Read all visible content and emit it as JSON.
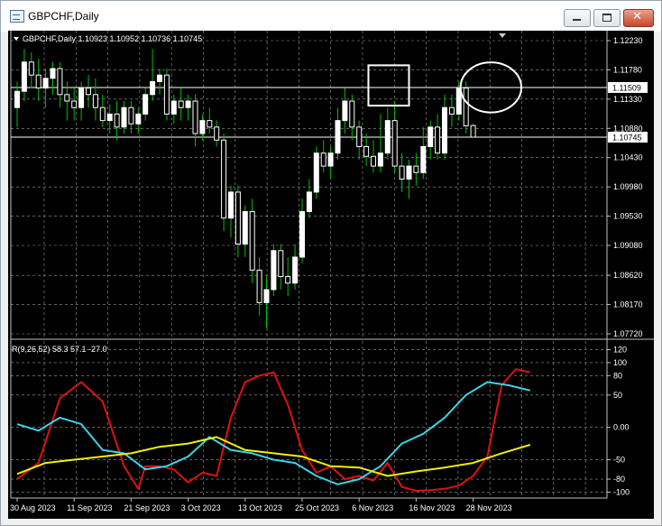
{
  "window": {
    "title": "GBPCHF,Daily"
  },
  "main_panel": {
    "header": "GBPCHF,Daily  1.10923 1.10952 1.10736 1.10745",
    "menu_arrow_icon": "triangle-down-icon"
  },
  "indicator_panel": {
    "header": "R(9,26,52) 58.3 57.1 -27.0"
  },
  "colors": {
    "background": "#000000",
    "grid": "#9a9a9a",
    "text": "#ffffff",
    "bull_candle": "#ffffff",
    "bear_candle": "#ffffff",
    "wick": "#00c000",
    "price_line": "#ffffff",
    "series_red": "#e01010",
    "series_cyan": "#3cd4e8",
    "series_yellow": "#f0f000",
    "annotation": "#ffffff",
    "price_label_bg": "#ffffff",
    "price_label_text": "#000000"
  },
  "chart_data": [
    {
      "type": "candlestick",
      "title": "GBPCHF,Daily",
      "ohlc_header": [
        "1.10923",
        "1.10952",
        "1.10736",
        "1.10745"
      ],
      "ylim": [
        1.0772,
        1.1223
      ],
      "yticks": [
        "1.12230",
        "1.11780",
        "1.11330",
        "1.10880",
        "1.10430",
        "1.09980",
        "1.09530",
        "1.09080",
        "1.08620",
        "1.08170",
        "1.07720"
      ],
      "x_labels": [
        "30 Aug 2023",
        "11 Sep 2023",
        "21 Sep 2023",
        "3 Oct 2023",
        "13 Oct 2023",
        "25 Oct 2023",
        "6 Nov 2023",
        "16 Nov 2023",
        "28 Nov 2023"
      ],
      "x_label_index": [
        0,
        8,
        16,
        24,
        32,
        40,
        48,
        56,
        64
      ],
      "price_lines": [
        {
          "value": 1.11509,
          "label": "1.11509"
        },
        {
          "value": 1.10745,
          "label": "1.10745"
        }
      ],
      "annotations": [
        {
          "shape": "rectangle",
          "from_index": 49.3,
          "to_index": 55.0,
          "y_top": 1.1185,
          "y_bottom": 1.1123
        },
        {
          "shape": "circle",
          "center_index": 66.5,
          "center_y": 1.1151,
          "radius_index": 3.0
        }
      ],
      "candles": [
        [
          1.112,
          1.116,
          1.109,
          1.1145
        ],
        [
          1.1145,
          1.121,
          1.113,
          1.119
        ],
        [
          1.119,
          1.1205,
          1.115,
          1.117
        ],
        [
          1.117,
          1.1195,
          1.113,
          1.115
        ],
        [
          1.115,
          1.118,
          1.112,
          1.1165
        ],
        [
          1.1165,
          1.119,
          1.114,
          1.118
        ],
        [
          1.118,
          1.119,
          1.112,
          1.114
        ],
        [
          1.114,
          1.116,
          1.11,
          1.113
        ],
        [
          1.113,
          1.115,
          1.11,
          1.112
        ],
        [
          1.112,
          1.116,
          1.11,
          1.115
        ],
        [
          1.115,
          1.117,
          1.112,
          1.114
        ],
        [
          1.114,
          1.1165,
          1.11,
          1.112
        ],
        [
          1.112,
          1.114,
          1.109,
          1.11
        ],
        [
          1.11,
          1.1125,
          1.108,
          1.111
        ],
        [
          1.111,
          1.113,
          1.107,
          1.109
        ],
        [
          1.109,
          1.113,
          1.108,
          1.112
        ],
        [
          1.112,
          1.113,
          1.108,
          1.1095
        ],
        [
          1.1095,
          1.112,
          1.108,
          1.111
        ],
        [
          1.111,
          1.115,
          1.11,
          1.114
        ],
        [
          1.114,
          1.121,
          1.113,
          1.116
        ],
        [
          1.116,
          1.118,
          1.114,
          1.117
        ],
        [
          1.117,
          1.118,
          1.11,
          1.111
        ],
        [
          1.111,
          1.114,
          1.1095,
          1.113
        ],
        [
          1.113,
          1.115,
          1.11,
          1.112
        ],
        [
          1.112,
          1.114,
          1.11,
          1.113
        ],
        [
          1.113,
          1.114,
          1.106,
          1.108
        ],
        [
          1.108,
          1.111,
          1.107,
          1.11
        ],
        [
          1.11,
          1.112,
          1.108,
          1.109
        ],
        [
          1.109,
          1.11,
          1.106,
          1.107
        ],
        [
          1.107,
          1.108,
          1.093,
          1.095
        ],
        [
          1.095,
          1.1,
          1.092,
          1.099
        ],
        [
          1.099,
          1.1,
          1.089,
          1.091
        ],
        [
          1.091,
          1.097,
          1.089,
          1.096
        ],
        [
          1.096,
          1.098,
          1.085,
          1.087
        ],
        [
          1.087,
          1.089,
          1.08,
          1.082
        ],
        [
          1.082,
          1.086,
          1.078,
          1.084
        ],
        [
          1.084,
          1.091,
          1.083,
          1.09
        ],
        [
          1.09,
          1.091,
          1.084,
          1.086
        ],
        [
          1.086,
          1.089,
          1.083,
          1.085
        ],
        [
          1.085,
          1.091,
          1.084,
          1.089
        ],
        [
          1.089,
          1.098,
          1.088,
          1.096
        ],
        [
          1.096,
          1.101,
          1.095,
          1.099
        ],
        [
          1.099,
          1.106,
          1.098,
          1.105
        ],
        [
          1.105,
          1.107,
          1.102,
          1.103
        ],
        [
          1.103,
          1.106,
          1.101,
          1.105
        ],
        [
          1.105,
          1.112,
          1.104,
          1.11
        ],
        [
          1.11,
          1.115,
          1.108,
          1.113
        ],
        [
          1.113,
          1.114,
          1.107,
          1.109
        ],
        [
          1.109,
          1.11,
          1.104,
          1.106
        ],
        [
          1.106,
          1.108,
          1.103,
          1.1045
        ],
        [
          1.1045,
          1.107,
          1.102,
          1.103
        ],
        [
          1.103,
          1.111,
          1.102,
          1.105
        ],
        [
          1.105,
          1.112,
          1.104,
          1.11
        ],
        [
          1.11,
          1.113,
          1.102,
          1.103
        ],
        [
          1.103,
          1.105,
          1.099,
          1.101
        ],
        [
          1.101,
          1.104,
          1.098,
          1.103
        ],
        [
          1.103,
          1.105,
          1.1,
          1.102
        ],
        [
          1.102,
          1.109,
          1.101,
          1.106
        ],
        [
          1.106,
          1.11,
          1.104,
          1.109
        ],
        [
          1.109,
          1.111,
          1.104,
          1.105
        ],
        [
          1.105,
          1.114,
          1.104,
          1.112
        ],
        [
          1.112,
          1.114,
          1.109,
          1.111
        ],
        [
          1.111,
          1.116,
          1.11,
          1.115
        ],
        [
          1.115,
          1.116,
          1.108,
          1.1092
        ],
        [
          1.10923,
          1.10952,
          1.10736,
          1.10745
        ]
      ]
    },
    {
      "type": "line",
      "title": "R(9,26,52)",
      "values_header": [
        "58.3",
        "57.1",
        "-27.0"
      ],
      "ylim": [
        -105,
        125
      ],
      "yticks": [
        "120",
        "100",
        "80",
        "50",
        "0.00",
        "-50",
        "-80",
        "-100"
      ],
      "ytick_values": [
        120,
        100,
        80,
        50,
        0,
        -50,
        -80,
        -100
      ],
      "series": [
        {
          "color": "series_red",
          "x": [
            0,
            3,
            6,
            9,
            12,
            15,
            17,
            18,
            20,
            22,
            24,
            26,
            28,
            30,
            32,
            34,
            36,
            38,
            40,
            42,
            44,
            46,
            48,
            50,
            52,
            54,
            56,
            58,
            60,
            62,
            64,
            66,
            68,
            70,
            72
          ],
          "values": [
            -80,
            -55,
            45,
            70,
            40,
            -60,
            -95,
            -60,
            -60,
            -65,
            -85,
            -70,
            -75,
            15,
            70,
            80,
            85,
            35,
            -35,
            -70,
            -60,
            -80,
            -75,
            -82,
            -55,
            -92,
            -98,
            -97,
            -95,
            -90,
            -75,
            -45,
            65,
            90,
            85
          ]
        },
        {
          "color": "series_cyan",
          "x": [
            0,
            3,
            6,
            9,
            12,
            15,
            18,
            21,
            24,
            27,
            30,
            33,
            36,
            39,
            42,
            45,
            48,
            51,
            54,
            57,
            60,
            63,
            66,
            69,
            72
          ],
          "values": [
            5,
            -5,
            15,
            5,
            -35,
            -40,
            -65,
            -60,
            -45,
            -15,
            -35,
            -40,
            -50,
            -55,
            -75,
            -88,
            -80,
            -60,
            -25,
            -10,
            15,
            50,
            70,
            65,
            57
          ]
        },
        {
          "color": "series_yellow",
          "x": [
            0,
            4,
            8,
            12,
            16,
            20,
            24,
            28,
            32,
            36,
            40,
            44,
            48,
            52,
            56,
            60,
            64,
            68,
            72
          ],
          "values": [
            -72,
            -55,
            -50,
            -45,
            -40,
            -30,
            -25,
            -15,
            -35,
            -40,
            -45,
            -60,
            -62,
            -75,
            -68,
            -62,
            -55,
            -40,
            -27
          ]
        }
      ]
    }
  ]
}
